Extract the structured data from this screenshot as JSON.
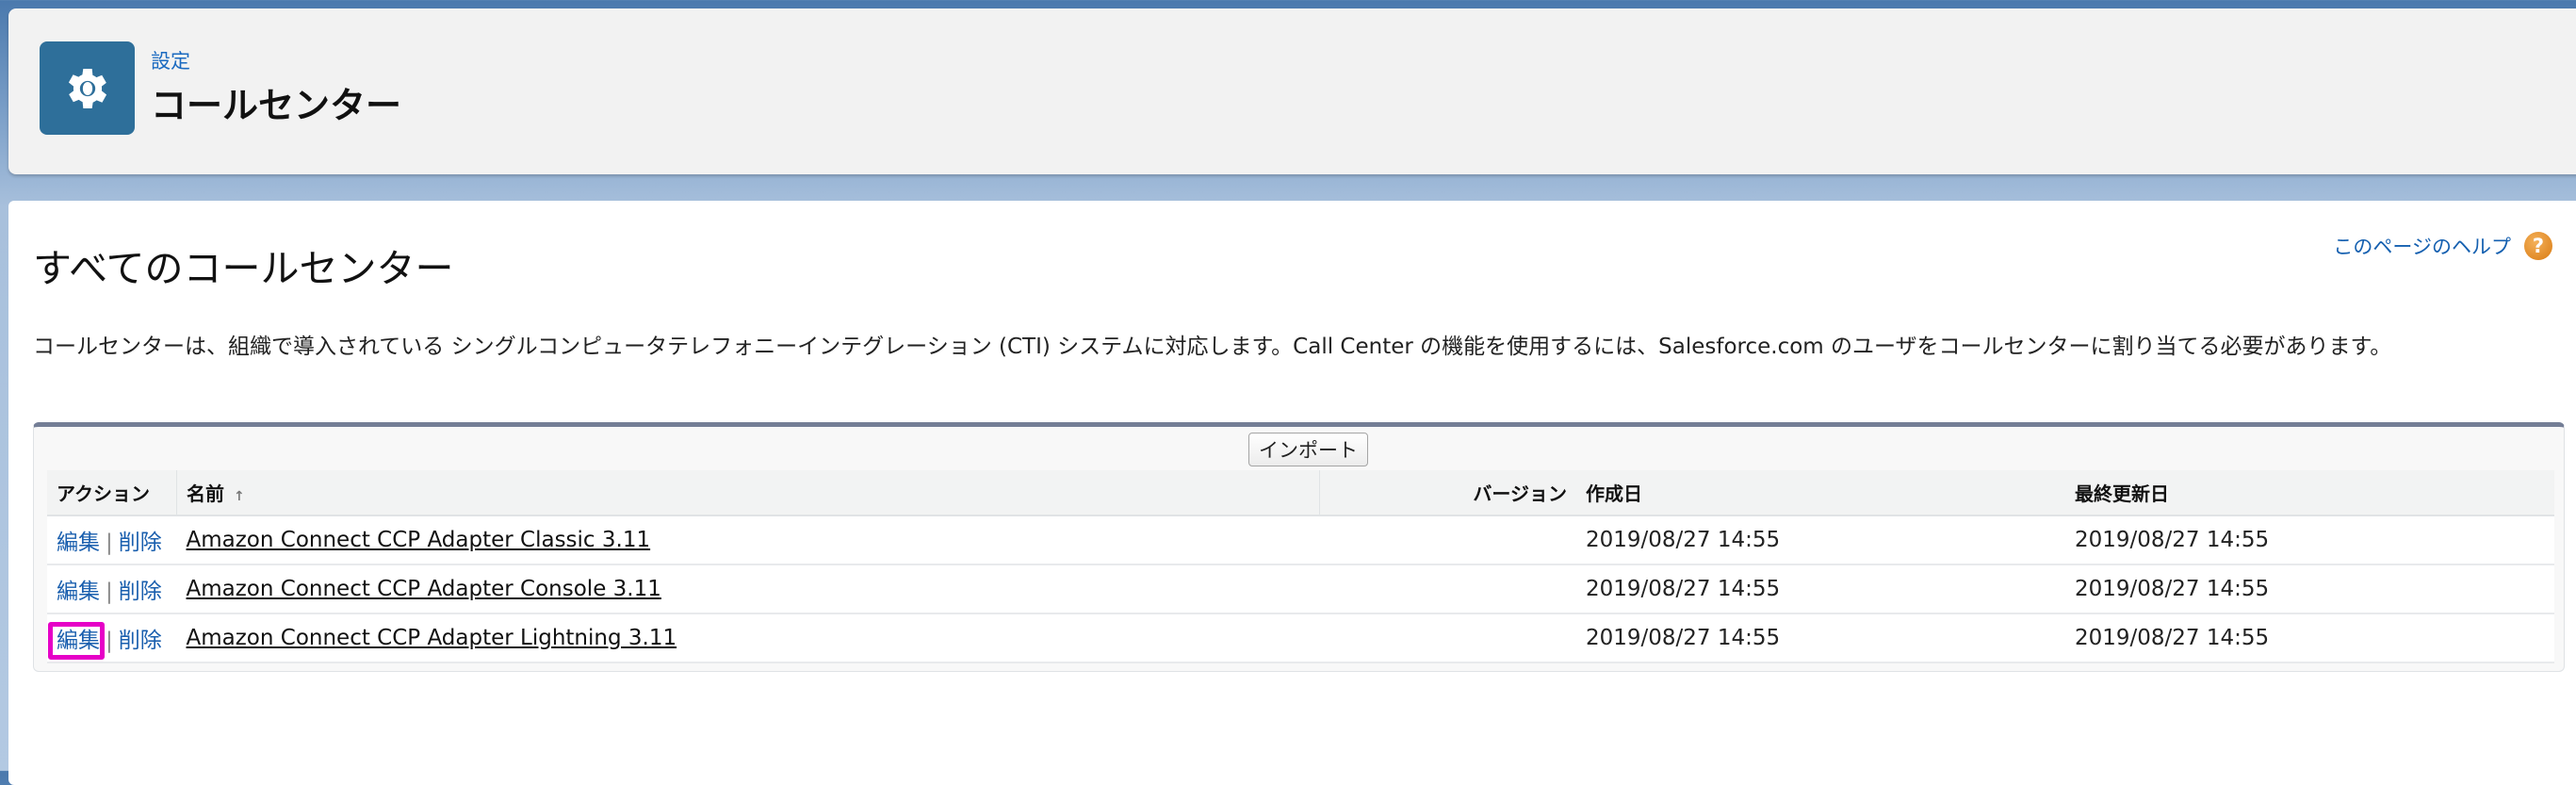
{
  "header": {
    "breadcrumb": "設定",
    "title": "コールセンター",
    "icon": "gear-icon",
    "icon_color": "#2e6f9a"
  },
  "page": {
    "title": "すべてのコールセンター",
    "help_link": "このページのヘルプ",
    "description": "コールセンターは、組織で導入されている シングルコンピュータテレフォニーインテグレーション (CTI) システムに対応します。Call Center の機能を使用するには、Salesforce.com のユーザをコールセンターに割り当てる必要があります。"
  },
  "table": {
    "import_button": "インポート",
    "columns": {
      "action": "アクション",
      "name": "名前",
      "sort_indicator": "↑",
      "version": "バージョン",
      "created": "作成日",
      "modified": "最終更新日"
    },
    "edit_label": "編集",
    "delete_label": "削除",
    "separator": "|",
    "rows": [
      {
        "name": "Amazon Connect CCP Adapter Classic 3.11",
        "version": "",
        "created": "2019/08/27 14:55",
        "modified": "2019/08/27 14:55"
      },
      {
        "name": "Amazon Connect CCP Adapter Console 3.11",
        "version": "",
        "created": "2019/08/27 14:55",
        "modified": "2019/08/27 14:55"
      },
      {
        "name": "Amazon Connect CCP Adapter Lightning 3.11",
        "version": "",
        "created": "2019/08/27 14:55",
        "modified": "2019/08/27 14:55",
        "highlighted_action": "edit"
      }
    ]
  },
  "highlight_color": "#e600c7"
}
